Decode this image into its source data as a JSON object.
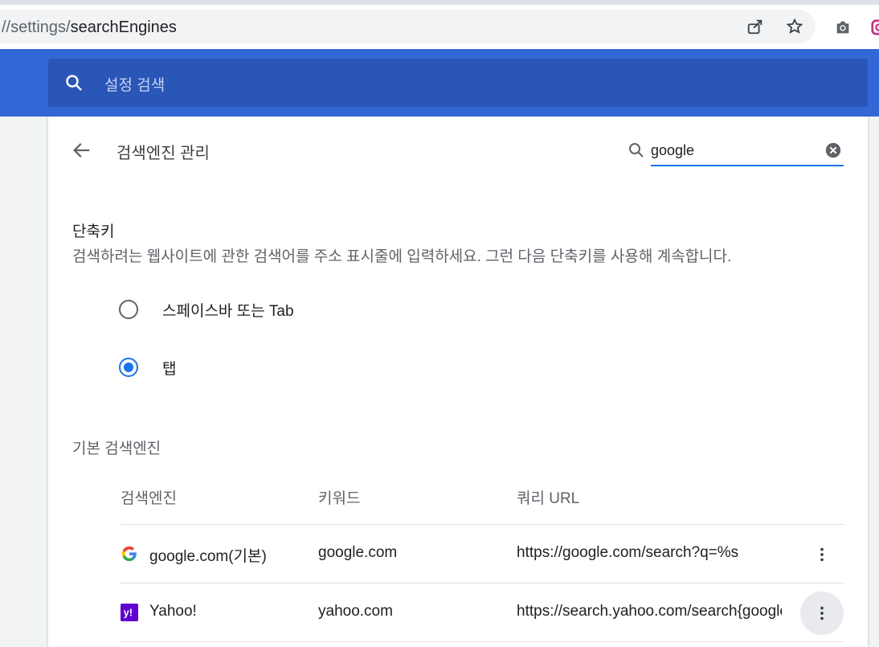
{
  "browser": {
    "url_dim": "//settings/",
    "url_main": "searchEngines",
    "icons": [
      "share-icon",
      "star-icon",
      "camera-icon",
      "extension-icon"
    ]
  },
  "search": {
    "placeholder": "설정 검색"
  },
  "page": {
    "title": "검색엔진 관리",
    "filter_value": "google"
  },
  "shortcut": {
    "title": "단축키",
    "description": "검색하려는 웹사이트에 관한 검색어를 주소 표시줄에 입력하세요. 그런 다음 단축키를 사용해 계속합니다.",
    "options": [
      {
        "label": "스페이스바 또는 Tab",
        "checked": false
      },
      {
        "label": "탭",
        "checked": true
      }
    ]
  },
  "default_engines": {
    "title": "기본 검색엔진",
    "columns": [
      "검색엔진",
      "키워드",
      "쿼리 URL"
    ],
    "rows": [
      {
        "name": "google.com(기본)",
        "keyword": "google.com",
        "url": "https://google.com/search?q=%s",
        "favicon": "google-favicon"
      },
      {
        "name": "Yahoo!",
        "keyword": "yahoo.com",
        "url": "https://search.yahoo.com/search{google:RLZ}{google:acceptedSuggestion}",
        "favicon": "yahoo-favicon"
      }
    ]
  },
  "colors": {
    "accent": "#1a73e8",
    "header_blue": "#3367d6",
    "search_blue": "#2a56b8"
  }
}
